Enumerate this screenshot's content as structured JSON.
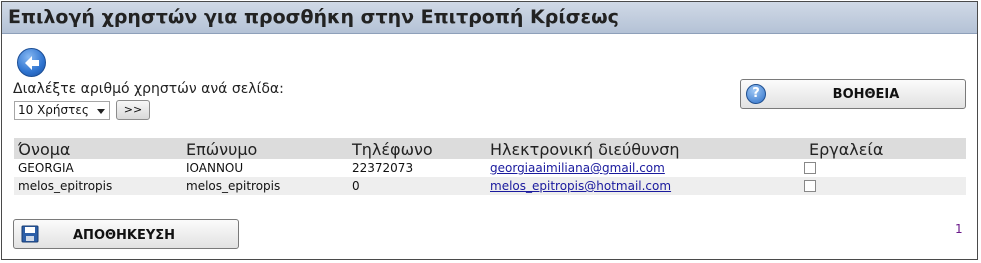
{
  "title": "Επιλογή χρηστών για προσθήκη στην Επιτροπή Κρίσεως",
  "back_icon": "back-arrow-icon",
  "per_page": {
    "label": "Διαλέξτε αριθμό χρηστών ανά σελίδα:",
    "selected": "10 Χρήστες",
    "go_label": ">>"
  },
  "help": {
    "label": "ΒΟΗΘΕΙΑ",
    "icon": "help-icon",
    "icon_glyph": "?"
  },
  "table": {
    "headers": [
      "Όνομα",
      "Επώνυμο",
      "Τηλέφωνο",
      "Ηλεκτρονική διεύθυνση",
      "Εργαλεία"
    ],
    "rows": [
      {
        "first": "GEORGIA",
        "last": "IOANNOU",
        "phone": "22372073",
        "email": "georgiaaimiliana@gmail.com"
      },
      {
        "first": "melos_epitropis",
        "last": "melos_epitropis",
        "phone": "0",
        "email": "melos_epitropis@hotmail.com"
      }
    ]
  },
  "save": {
    "label": "ΑΠΟΘΗΚΕΥΣΗ",
    "icon": "floppy-disk-icon"
  },
  "pagination": {
    "current": "1"
  },
  "colors": {
    "title_bar": "#c4cfdf",
    "header_row": "#dcdcdc",
    "link": "#1a1a9e",
    "page_link": "#6a1a8a"
  }
}
